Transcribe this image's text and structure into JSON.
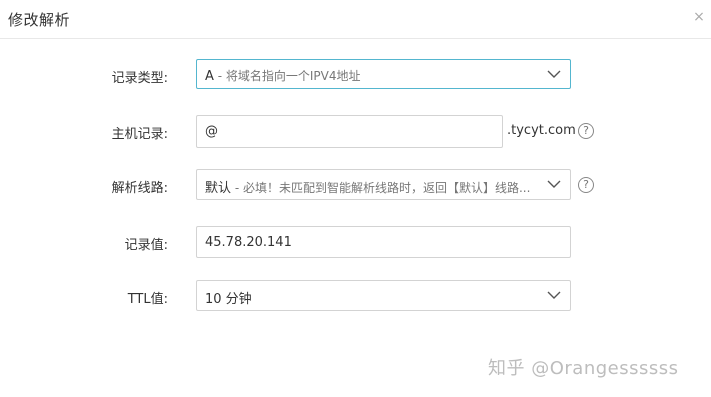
{
  "dialog": {
    "title": "修改解析",
    "close_label": "×"
  },
  "form": {
    "record_type": {
      "label": "记录类型:",
      "value_main": "A",
      "value_hint": " - 将域名指向一个IPV4地址"
    },
    "host_record": {
      "label": "主机记录:",
      "value": "@",
      "domain_suffix": ".tycyt.com",
      "help": "?"
    },
    "resolve_line": {
      "label": "解析线路:",
      "value_main": "默认",
      "value_hint": " - 必填！未匹配到智能解析线路时，返回【默认】线路...",
      "help": "?"
    },
    "record_value": {
      "label": "记录值:",
      "value": "45.78.20.141"
    },
    "ttl": {
      "label": "TTL值:",
      "value": "10 分钟"
    }
  },
  "watermark": {
    "text": "知乎 @Orangessssss"
  },
  "icons": {
    "close": "close-icon",
    "chevron": "chevron-down-icon",
    "help": "help-circle-icon"
  },
  "colors": {
    "active_border": "#54b6cf",
    "border": "#d3d3d3",
    "watermark": "#bdbdbd"
  }
}
